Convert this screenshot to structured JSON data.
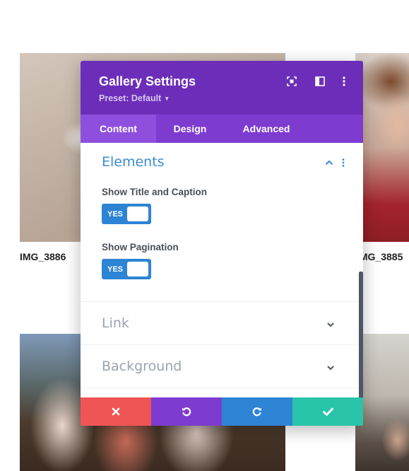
{
  "gallery": {
    "captions": [
      "IMG_3886",
      "IMG_3885"
    ]
  },
  "modal": {
    "title": "Gallery Settings",
    "preset": "Preset: Default",
    "header_icons": [
      "focus-mode-icon",
      "split-view-icon",
      "more-options-icon"
    ],
    "tabs": [
      {
        "label": "Content",
        "active": true
      },
      {
        "label": "Design",
        "active": false
      },
      {
        "label": "Advanced",
        "active": false
      }
    ],
    "sections": {
      "elements": {
        "title": "Elements",
        "expanded": true,
        "fields": [
          {
            "label": "Show Title and Caption",
            "toggle": "YES"
          },
          {
            "label": "Show Pagination",
            "toggle": "YES"
          }
        ]
      },
      "link": {
        "title": "Link",
        "expanded": false
      },
      "background": {
        "title": "Background",
        "expanded": false
      }
    },
    "footer": [
      "close-icon",
      "undo-icon",
      "redo-icon",
      "check-icon"
    ]
  },
  "colors": {
    "header": "#6c2eb9",
    "tabs": "#7e3bd0",
    "active_tab": "#8f4fde",
    "accent_blue": "#2d84d4",
    "close": "#ef5555",
    "save": "#29c4a9"
  }
}
